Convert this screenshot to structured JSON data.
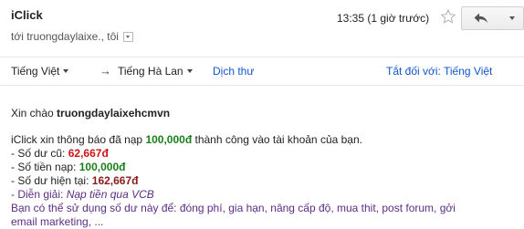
{
  "email": {
    "sender": "iClick",
    "recipient": "tới truongdaylaixe., tôi",
    "timestamp": "13:35 (1 giờ trước)"
  },
  "translate_bar": {
    "source_lang": "Tiếng Việt",
    "target_lang": "Tiếng Hà Lan",
    "translate_link": "Dịch thư",
    "turn_off_link": "Tắt đối với: Tiếng Việt"
  },
  "body": {
    "greeting_prefix": "Xin chào",
    "greeting_name": "truongdaylaixehcmvn",
    "notice_prefix": "iClick xin thông báo đã nạp",
    "notice_amount": "100,000đ",
    "notice_suffix": "thành công vào tài khoản của bạn.",
    "old_balance_label": "- Số dư cũ:",
    "old_balance_value": "62,667đ",
    "deposit_label": "- Số tiền nạp:",
    "deposit_value": "100,000đ",
    "current_balance_label": "- Số dư hiện tại:",
    "current_balance_value": "162,667đ",
    "explanation_label": "- Diễn giải:",
    "explanation_value": "Nạp tiền qua VCB",
    "usage_line1": "Bạn có thể sử dụng số dư này để: đóng phí, gia hạn, nâng cấp độ, mua thit, post forum, gởi",
    "usage_line2": "email marketing, ..."
  }
}
